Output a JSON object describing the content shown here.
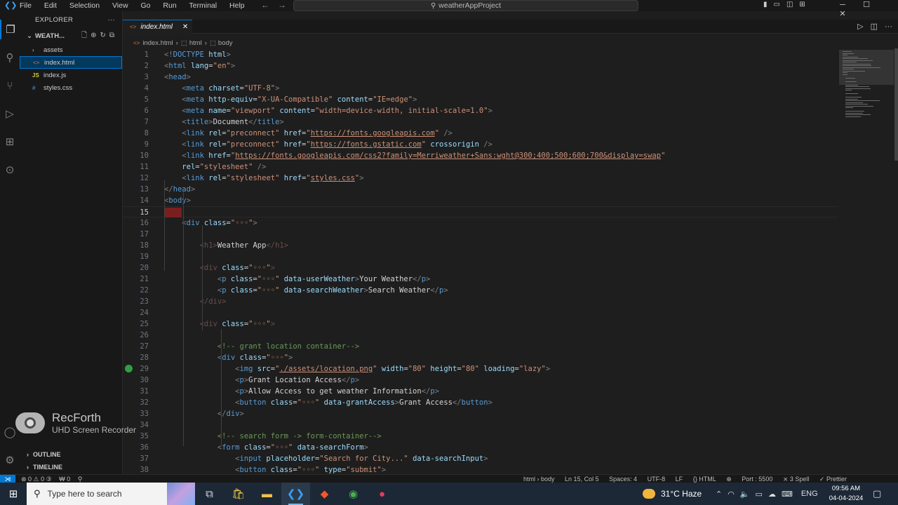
{
  "titlebar": {
    "menu": [
      "File",
      "Edit",
      "Selection",
      "View",
      "Go",
      "Run",
      "Terminal",
      "Help"
    ],
    "search_text": "weatherAppProject"
  },
  "activity": [
    "explorer-icon",
    "search-icon",
    "source-control-icon",
    "run-debug-icon",
    "extensions-icon",
    "remote-icon"
  ],
  "sidebar": {
    "title": "EXPLORER",
    "folder": "WEATH...",
    "items": [
      {
        "label": "assets",
        "type": "folder"
      },
      {
        "label": "index.html",
        "type": "html",
        "selected": true
      },
      {
        "label": "index.js",
        "type": "js"
      },
      {
        "label": "styles.css",
        "type": "css"
      }
    ],
    "outline": "OUTLINE",
    "timeline": "TIMELINE"
  },
  "recorder": {
    "brand": "RecForth",
    "tagline": "UHD Screen Recorder"
  },
  "tab": {
    "label": "index.html"
  },
  "breadcrumb": [
    "index.html",
    "html",
    "body"
  ],
  "editor": {
    "current_line": 15,
    "lines": [
      {
        "n": "1",
        "html": "<span class='tg'>&lt;!</span><span class='tn'>DOCTYPE</span> <span class='at'>html</span><span class='tg'>&gt;</span>"
      },
      {
        "n": "2",
        "html": "<span class='tg'>&lt;</span><span class='tn'>html</span> <span class='at'>lang</span>=<span class='st'>\"en\"</span><span class='tg'>&gt;</span>"
      },
      {
        "n": "3",
        "html": "<span class='tg'>&lt;</span><span class='tn'>head</span><span class='tg'>&gt;</span>"
      },
      {
        "n": "4",
        "html": "    <span class='tg'>&lt;</span><span class='tn'>meta</span> <span class='at'>charset</span>=<span class='st'>\"UTF-8\"</span><span class='tg'>&gt;</span>"
      },
      {
        "n": "5",
        "html": "    <span class='tg'>&lt;</span><span class='tn'>meta</span> <span class='at'>http-equiv</span>=<span class='st'>\"X-UA-Compatible\"</span> <span class='at'>content</span>=<span class='st'>\"IE=edge\"</span><span class='tg'>&gt;</span>"
      },
      {
        "n": "6",
        "html": "    <span class='tg'>&lt;</span><span class='tn'>meta</span> <span class='at'>name</span>=<span class='st'>\"viewport\"</span> <span class='at'>content</span>=<span class='st'>\"width=device-width, initial-scale=1.0\"</span><span class='tg'>&gt;</span>"
      },
      {
        "n": "7",
        "html": "    <span class='tg'>&lt;</span><span class='tn'>title</span><span class='tg'>&gt;</span><span class='tx'>Document</span><span class='tg'>&lt;/</span><span class='tn'>title</span><span class='tg'>&gt;</span>"
      },
      {
        "n": "8",
        "html": "    <span class='tg'>&lt;</span><span class='tn'>link</span> <span class='at'>rel</span>=<span class='st'>\"preconnect\"</span> <span class='at'>href</span>=<span class='st'>\"<span class='ul'>https://fonts.googleapis.com</span>\"</span> <span class='tg'>/&gt;</span>"
      },
      {
        "n": "9",
        "html": "    <span class='tg'>&lt;</span><span class='tn'>link</span> <span class='at'>rel</span>=<span class='st'>\"preconnect\"</span> <span class='at'>href</span>=<span class='st'>\"<span class='ul'>https://fonts.gstatic.com</span>\"</span> <span class='at'>crossorigin</span> <span class='tg'>/&gt;</span>"
      },
      {
        "n": "10",
        "html": "    <span class='tg'>&lt;</span><span class='tn'>link</span> <span class='at'>href</span>=<span class='st'>\"<span class='ul'>https://fonts.googleapis.com/css2?family=Merriweather+Sans:wght@300;400;500;600;700&amp;display=swap</span>\"</span>"
      },
      {
        "n": "11",
        "html": "    <span class='at'>rel</span>=<span class='st'>\"stylesheet\"</span> <span class='tg'>/&gt;</span>"
      },
      {
        "n": "12",
        "html": "    <span class='tg'>&lt;</span><span class='tn'>link</span> <span class='at'>rel</span>=<span class='st'>\"stylesheet\"</span> <span class='at'>href</span>=<span class='st'>\"<span class='ul'>styles.css</span>\"</span><span class='tg'>&gt;</span>"
      },
      {
        "n": "13",
        "html": "<span class='tg'>&lt;/</span><span class='tn'>head</span><span class='tg'>&gt;</span>"
      },
      {
        "n": "14",
        "html": "<span class='tg'>&lt;</span><span class='tn'>body</span><span class='tg'>&gt;</span>"
      },
      {
        "n": "15",
        "html": "<span class='cursorblk'></span>"
      },
      {
        "n": "16",
        "html": "    <span class='tg'>&lt;</span><span class='tn'>div</span> <span class='at'>class</span>=<span class='st'>\"◦◦◦\"</span><span class='tg'>&gt;</span>"
      },
      {
        "n": "17",
        "html": ""
      },
      {
        "n": "18",
        "html": "        <span class='dim'>&lt;h1&gt;</span><span class='tx'>Weather App</span><span class='dim'>&lt;/h1&gt;</span>"
      },
      {
        "n": "19",
        "html": ""
      },
      {
        "n": "20",
        "html": "        <span class='dim'>&lt;div</span> <span class='at'>class</span>=<span class='st'>\"◦◦◦\"</span><span class='dim'>&gt;</span>"
      },
      {
        "n": "21",
        "html": "            <span class='tg'>&lt;</span><span class='tn'>p</span> <span class='at'>class</span>=<span class='st'>\"◦◦◦\"</span> <span class='at'>data-userWeather</span><span class='tg'>&gt;</span><span class='tx'>Your Weather</span><span class='tg'>&lt;/</span><span class='tn'>p</span><span class='tg'>&gt;</span>"
      },
      {
        "n": "22",
        "html": "            <span class='tg'>&lt;</span><span class='tn'>p</span> <span class='at'>class</span>=<span class='st'>\"◦◦◦\"</span> <span class='at'>data-searchWeather</span><span class='tg'>&gt;</span><span class='tx'>Search Weather</span><span class='tg'>&lt;/</span><span class='tn'>p</span><span class='tg'>&gt;</span>"
      },
      {
        "n": "23",
        "html": "        <span class='dim'>&lt;/div&gt;</span>"
      },
      {
        "n": "24",
        "html": ""
      },
      {
        "n": "25",
        "html": "        <span class='dim'>&lt;div</span> <span class='at'>class</span>=<span class='st'>\"◦◦◦\"</span><span class='dim'>&gt;</span>"
      },
      {
        "n": "26",
        "html": ""
      },
      {
        "n": "27",
        "html": "            <span class='cm'>&lt;!-- grant location container--&gt;</span>"
      },
      {
        "n": "28",
        "html": "            <span class='tg'>&lt;</span><span class='tn'>div</span> <span class='at'>class</span>=<span class='st'>\"◦◦◦\"</span><span class='tg'>&gt;</span>"
      },
      {
        "n": "29",
        "html": "                <span class='tg'>&lt;</span><span class='tn'>img</span> <span class='at'>src</span>=<span class='st'>\"<span class='ul'>./assets/location.png</span>\"</span> <span class='at'>width</span>=<span class='st'>\"80\"</span> <span class='at'>height</span>=<span class='st'>\"80\"</span> <span class='at'>loading</span>=<span class='st'>\"lazy\"</span><span class='tg'>&gt;</span>"
      },
      {
        "n": "30",
        "html": "                <span class='tg'>&lt;</span><span class='tn'>p</span><span class='tg'>&gt;</span><span class='tx'>Grant Location Access</span><span class='tg'>&lt;/</span><span class='tn'>p</span><span class='tg'>&gt;</span>"
      },
      {
        "n": "31",
        "html": "                <span class='tg'>&lt;</span><span class='tn'>p</span><span class='tg'>&gt;</span><span class='tx'>Allow Access to get weather Information</span><span class='tg'>&lt;/</span><span class='tn'>p</span><span class='tg'>&gt;</span>"
      },
      {
        "n": "32",
        "html": "                <span class='tg'>&lt;</span><span class='tn'>button</span> <span class='at'>class</span>=<span class='st'>\"◦◦◦\"</span> <span class='at'>data-grantAccess</span><span class='tg'>&gt;</span><span class='tx'>Grant Access</span><span class='tg'>&lt;/</span><span class='tn'>button</span><span class='tg'>&gt;</span>"
      },
      {
        "n": "33",
        "html": "            <span class='tg'>&lt;/</span><span class='tn'>div</span><span class='tg'>&gt;</span>"
      },
      {
        "n": "34",
        "html": ""
      },
      {
        "n": "35",
        "html": "            <span class='cm'>&lt;!-- search form -&gt; form-container--&gt;</span>"
      },
      {
        "n": "36",
        "html": "            <span class='tg'>&lt;</span><span class='tn'>form</span> <span class='at'>class</span>=<span class='st'>\"◦◦◦\"</span> <span class='at'>data-searchForm</span><span class='tg'>&gt;</span>"
      },
      {
        "n": "37",
        "html": "                <span class='tg'>&lt;</span><span class='tn'>input</span> <span class='at'>placeholder</span>=<span class='st'>\"Search for City...\"</span> <span class='at'>data-searchInput</span><span class='tg'>&gt;</span>"
      },
      {
        "n": "38",
        "html": "                <span class='tg'>&lt;</span><span class='tn'>button</span> <span class='at'>class</span>=<span class='st'>\"◦◦◦\"</span> <span class='at'>type</span>=<span class='st'>\"submit\"</span><span class='tg'>&gt;</span>"
      }
    ]
  },
  "statusbar": {
    "left": [
      "⊗ 0 ⚠ 0 ③",
      "₩ 0",
      "⚲"
    ],
    "right": [
      "html › body",
      "Ln 15, Col 5",
      "Spaces: 4",
      "UTF-8",
      "LF",
      "{} HTML",
      "⊕",
      "Port : 5500",
      "⨯ 3 Spell",
      "✓ Prettier"
    ]
  },
  "taskbar": {
    "search_placeholder": "Type here to search",
    "weather": "31°C  Haze",
    "lang": "ENG",
    "time": "09:56 AM",
    "date": "04-04-2024"
  }
}
